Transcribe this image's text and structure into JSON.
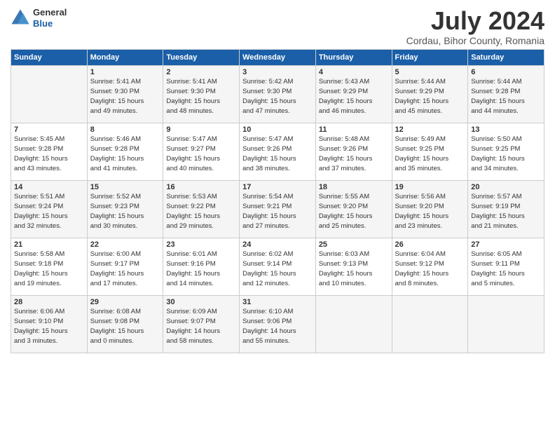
{
  "header": {
    "logo_general": "General",
    "logo_blue": "Blue",
    "title": "July 2024",
    "subtitle": "Cordau, Bihor County, Romania"
  },
  "days_of_week": [
    "Sunday",
    "Monday",
    "Tuesday",
    "Wednesday",
    "Thursday",
    "Friday",
    "Saturday"
  ],
  "weeks": [
    [
      {
        "day": "",
        "info": ""
      },
      {
        "day": "1",
        "info": "Sunrise: 5:41 AM\nSunset: 9:30 PM\nDaylight: 15 hours\nand 49 minutes."
      },
      {
        "day": "2",
        "info": "Sunrise: 5:41 AM\nSunset: 9:30 PM\nDaylight: 15 hours\nand 48 minutes."
      },
      {
        "day": "3",
        "info": "Sunrise: 5:42 AM\nSunset: 9:30 PM\nDaylight: 15 hours\nand 47 minutes."
      },
      {
        "day": "4",
        "info": "Sunrise: 5:43 AM\nSunset: 9:29 PM\nDaylight: 15 hours\nand 46 minutes."
      },
      {
        "day": "5",
        "info": "Sunrise: 5:44 AM\nSunset: 9:29 PM\nDaylight: 15 hours\nand 45 minutes."
      },
      {
        "day": "6",
        "info": "Sunrise: 5:44 AM\nSunset: 9:28 PM\nDaylight: 15 hours\nand 44 minutes."
      }
    ],
    [
      {
        "day": "7",
        "info": "Sunrise: 5:45 AM\nSunset: 9:28 PM\nDaylight: 15 hours\nand 43 minutes."
      },
      {
        "day": "8",
        "info": "Sunrise: 5:46 AM\nSunset: 9:28 PM\nDaylight: 15 hours\nand 41 minutes."
      },
      {
        "day": "9",
        "info": "Sunrise: 5:47 AM\nSunset: 9:27 PM\nDaylight: 15 hours\nand 40 minutes."
      },
      {
        "day": "10",
        "info": "Sunrise: 5:47 AM\nSunset: 9:26 PM\nDaylight: 15 hours\nand 38 minutes."
      },
      {
        "day": "11",
        "info": "Sunrise: 5:48 AM\nSunset: 9:26 PM\nDaylight: 15 hours\nand 37 minutes."
      },
      {
        "day": "12",
        "info": "Sunrise: 5:49 AM\nSunset: 9:25 PM\nDaylight: 15 hours\nand 35 minutes."
      },
      {
        "day": "13",
        "info": "Sunrise: 5:50 AM\nSunset: 9:25 PM\nDaylight: 15 hours\nand 34 minutes."
      }
    ],
    [
      {
        "day": "14",
        "info": "Sunrise: 5:51 AM\nSunset: 9:24 PM\nDaylight: 15 hours\nand 32 minutes."
      },
      {
        "day": "15",
        "info": "Sunrise: 5:52 AM\nSunset: 9:23 PM\nDaylight: 15 hours\nand 30 minutes."
      },
      {
        "day": "16",
        "info": "Sunrise: 5:53 AM\nSunset: 9:22 PM\nDaylight: 15 hours\nand 29 minutes."
      },
      {
        "day": "17",
        "info": "Sunrise: 5:54 AM\nSunset: 9:21 PM\nDaylight: 15 hours\nand 27 minutes."
      },
      {
        "day": "18",
        "info": "Sunrise: 5:55 AM\nSunset: 9:20 PM\nDaylight: 15 hours\nand 25 minutes."
      },
      {
        "day": "19",
        "info": "Sunrise: 5:56 AM\nSunset: 9:20 PM\nDaylight: 15 hours\nand 23 minutes."
      },
      {
        "day": "20",
        "info": "Sunrise: 5:57 AM\nSunset: 9:19 PM\nDaylight: 15 hours\nand 21 minutes."
      }
    ],
    [
      {
        "day": "21",
        "info": "Sunrise: 5:58 AM\nSunset: 9:18 PM\nDaylight: 15 hours\nand 19 minutes."
      },
      {
        "day": "22",
        "info": "Sunrise: 6:00 AM\nSunset: 9:17 PM\nDaylight: 15 hours\nand 17 minutes."
      },
      {
        "day": "23",
        "info": "Sunrise: 6:01 AM\nSunset: 9:16 PM\nDaylight: 15 hours\nand 14 minutes."
      },
      {
        "day": "24",
        "info": "Sunrise: 6:02 AM\nSunset: 9:14 PM\nDaylight: 15 hours\nand 12 minutes."
      },
      {
        "day": "25",
        "info": "Sunrise: 6:03 AM\nSunset: 9:13 PM\nDaylight: 15 hours\nand 10 minutes."
      },
      {
        "day": "26",
        "info": "Sunrise: 6:04 AM\nSunset: 9:12 PM\nDaylight: 15 hours\nand 8 minutes."
      },
      {
        "day": "27",
        "info": "Sunrise: 6:05 AM\nSunset: 9:11 PM\nDaylight: 15 hours\nand 5 minutes."
      }
    ],
    [
      {
        "day": "28",
        "info": "Sunrise: 6:06 AM\nSunset: 9:10 PM\nDaylight: 15 hours\nand 3 minutes."
      },
      {
        "day": "29",
        "info": "Sunrise: 6:08 AM\nSunset: 9:08 PM\nDaylight: 15 hours\nand 0 minutes."
      },
      {
        "day": "30",
        "info": "Sunrise: 6:09 AM\nSunset: 9:07 PM\nDaylight: 14 hours\nand 58 minutes."
      },
      {
        "day": "31",
        "info": "Sunrise: 6:10 AM\nSunset: 9:06 PM\nDaylight: 14 hours\nand 55 minutes."
      },
      {
        "day": "",
        "info": ""
      },
      {
        "day": "",
        "info": ""
      },
      {
        "day": "",
        "info": ""
      }
    ]
  ]
}
